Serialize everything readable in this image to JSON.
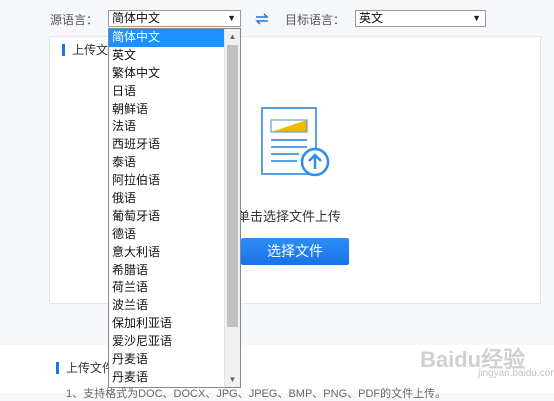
{
  "source": {
    "label": "源语言：",
    "value": "简体中文"
  },
  "target": {
    "label": "目标语言：",
    "value": "英文"
  },
  "panel": {
    "title": "上传文件",
    "upload_text": "单击选择文件上传",
    "button": "选择文件"
  },
  "lower": {
    "title": "上传文件",
    "text": "1、支持格式为DOC、DOCX、JPG、JPEG、BMP、PNG、PDF的文件上传。"
  },
  "watermark": {
    "text": "Baidu经验",
    "sub": "jingyan.baidu.com"
  },
  "dropdown": {
    "options": [
      "简体中文",
      "英文",
      "繁体中文",
      "日语",
      "朝鲜语",
      "法语",
      "西班牙语",
      "泰语",
      "阿拉伯语",
      "俄语",
      "葡萄牙语",
      "德语",
      "意大利语",
      "希腊语",
      "荷兰语",
      "波兰语",
      "保加利亚语",
      "爱沙尼亚语",
      "丹麦语",
      "丹麦语"
    ],
    "selected_index": 0
  },
  "colors": {
    "accent": "#1a73e8",
    "selected": "#1e90ff"
  }
}
